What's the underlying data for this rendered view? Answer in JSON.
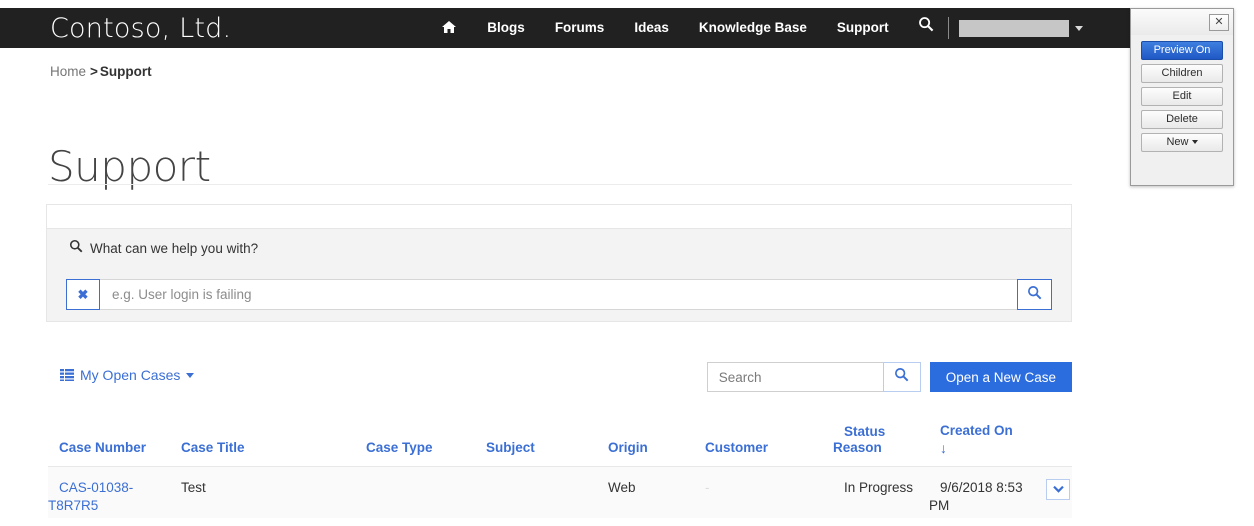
{
  "navbar": {
    "brand": "Contoso, Ltd.",
    "home_icon": "home-icon",
    "links": [
      "Blogs",
      "Forums",
      "Ideas",
      "Knowledge Base",
      "Support"
    ],
    "search_icon": "search-icon",
    "user_caret_icon": "chevron-down-icon"
  },
  "breadcrumb": {
    "home": "Home",
    "separator": ">",
    "current": "Support"
  },
  "page": {
    "title": "Support"
  },
  "kb_search": {
    "heading_icon": "search-icon",
    "heading": "What can we help you with?",
    "clear_icon": "✖",
    "input_value": "",
    "input_placeholder": "e.g. User login is failing",
    "submit_icon": "search-icon"
  },
  "cases_toolbar": {
    "view_icon": "list-icon",
    "view_label": "My Open Cases",
    "view_caret_icon": "caret-down-icon",
    "search_value": "",
    "search_placeholder": "Search",
    "search_icon": "search-icon",
    "new_case_label": "Open a New Case"
  },
  "cases_table": {
    "columns": [
      "Case Number",
      "Case Title",
      "Case Type",
      "Subject",
      "Origin",
      "Customer",
      "Status Reason",
      "Created On"
    ],
    "sort_column": "Created On",
    "sort_arrow": "↓",
    "rows": [
      {
        "case_number": "CAS-01038-T8R7R5",
        "case_title": "Test",
        "case_type": "",
        "subject": "",
        "origin": "Web",
        "customer": "-",
        "status_reason": "In Progress",
        "created_on": "9/6/2018 8:53 PM",
        "row_menu_icon": "chevron-down-icon"
      }
    ]
  },
  "edit_panel": {
    "close_label": "✕",
    "buttons": [
      {
        "label": "Preview On",
        "primary": true,
        "has_caret": false
      },
      {
        "label": "Children",
        "primary": false,
        "has_caret": false
      },
      {
        "label": "Edit",
        "primary": false,
        "has_caret": false
      },
      {
        "label": "Delete",
        "primary": false,
        "has_caret": false
      },
      {
        "label": "New",
        "primary": false,
        "has_caret": true
      }
    ]
  },
  "colors": {
    "navbar_bg": "#212121",
    "accent_blue": "#3b6fd4",
    "button_blue": "#2b6cdf",
    "panel_bg": "#f3f3f3",
    "row_bg": "#fafafa"
  }
}
